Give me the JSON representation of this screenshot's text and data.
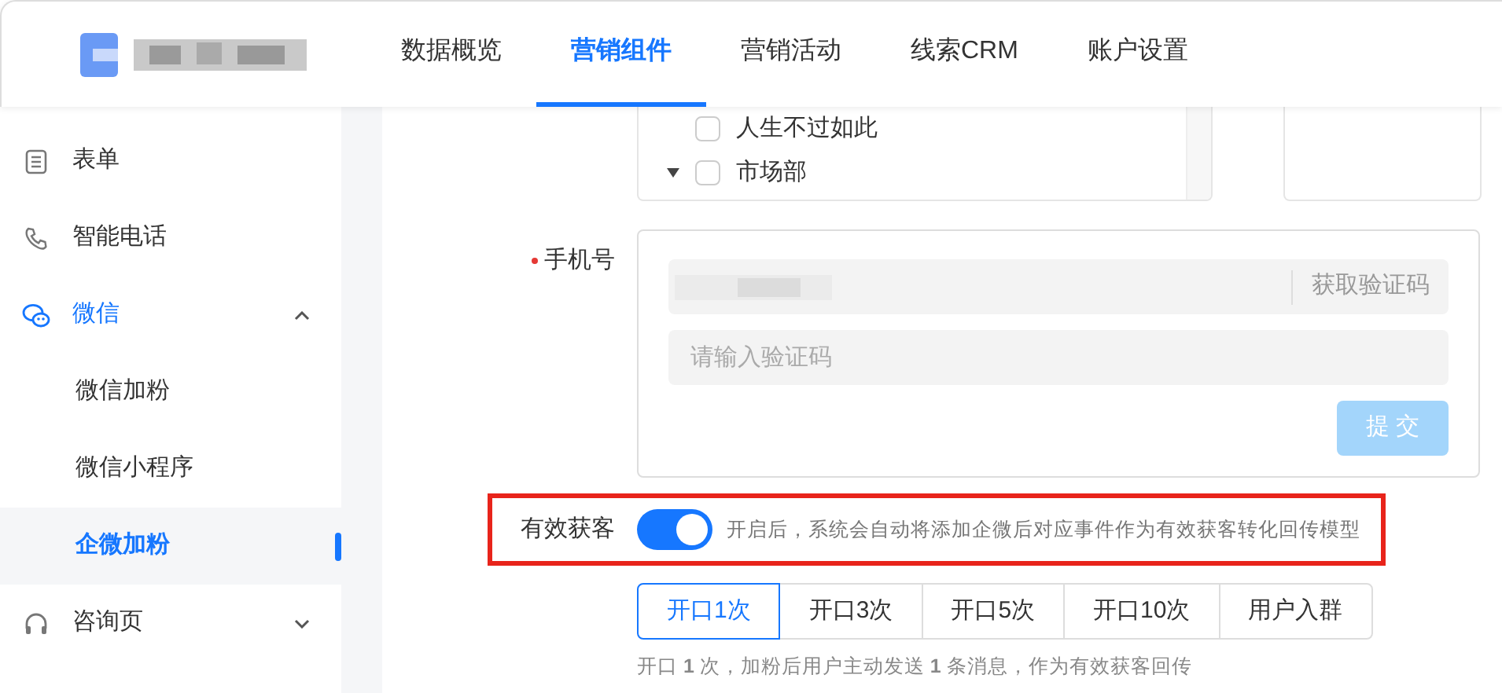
{
  "top_nav": {
    "tabs": [
      {
        "label": "数据概览",
        "selected": false
      },
      {
        "label": "营销组件",
        "selected": true
      },
      {
        "label": "营销活动",
        "selected": false
      },
      {
        "label": "线索CRM",
        "selected": false
      },
      {
        "label": "账户设置",
        "selected": false
      }
    ]
  },
  "sidebar": {
    "items": [
      {
        "label": "表单",
        "kind": "item",
        "selected": false
      },
      {
        "label": "智能电话",
        "kind": "item",
        "selected": false
      },
      {
        "label": "微信",
        "kind": "group",
        "selected": true,
        "expanded": true,
        "children": [
          {
            "label": "微信加粉",
            "selected": false
          },
          {
            "label": "微信小程序",
            "selected": false
          },
          {
            "label": "企微加粉",
            "selected": true
          }
        ]
      },
      {
        "label": "咨询页",
        "kind": "group",
        "selected": false,
        "expanded": false
      }
    ]
  },
  "tree": {
    "items": [
      {
        "label": "人生不过如此",
        "checked": false,
        "kind": "leaf"
      },
      {
        "label": "市场部",
        "checked": false,
        "kind": "folder",
        "expanded": true
      }
    ]
  },
  "phone_form": {
    "label": "手机号",
    "required": true,
    "code_button": "获取验证码",
    "code_field": {
      "placeholder": "请输入验证码"
    },
    "submit": "提 交",
    "submit_disabled": true
  },
  "effective_lead": {
    "label": "有效获客",
    "on": true,
    "hint": "开启后，系统会自动将添加企微后对应事件作为有效获客转化回传模型",
    "options": [
      {
        "label": "开口1次",
        "selected": true
      },
      {
        "label": "开口3次",
        "selected": false
      },
      {
        "label": "开口5次",
        "selected": false
      },
      {
        "label": "开口10次",
        "selected": false
      },
      {
        "label": "用户入群",
        "selected": false
      }
    ],
    "note": "开口 **1** 次，加粉后用户主动发送 **1** 条消息，作为有效获客回传"
  }
}
